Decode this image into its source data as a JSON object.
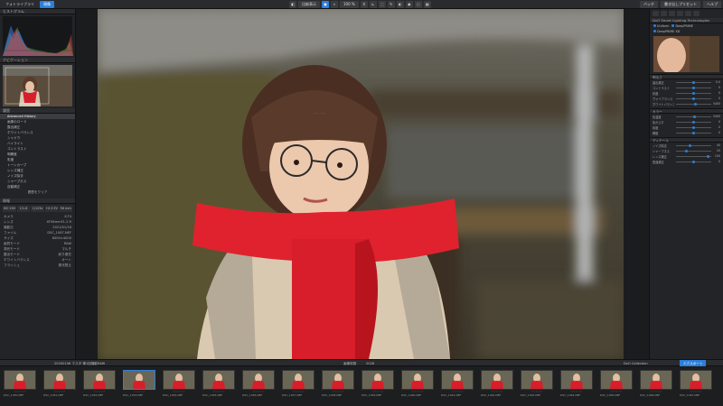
{
  "topbar": {
    "tab_library": "フォトライブラリ",
    "tab_develop": "現像",
    "zoom_label": "100 %",
    "mode_label": "比較表示",
    "button_batch": "バッチ",
    "button_export": "書き出しプリセット",
    "button_help": "ヘルプ"
  },
  "left": {
    "panel_title": "ヒストグラム",
    "histogram_title": "ヒストグラム",
    "navigator_title": "ナビゲーション",
    "history_title": "履歴",
    "history_head": "Advanced History",
    "history_items": [
      "画像のロード",
      "露出補正",
      "ホワイトバランス",
      "シャドウ",
      "ハイライト",
      "コントラスト",
      "明瞭度",
      "彩度",
      "トーンカーブ",
      "レンズ補正",
      "ノイズ除去",
      "シャープネス",
      "自動補正"
    ],
    "history_action": "履歴をクリア",
    "section_info": "情報",
    "camera_buttons": [
      "ISO 200",
      "1/1.8",
      "1/125s",
      "+0.3 EV",
      "56 mm"
    ],
    "info_rows": [
      {
        "k": "カメラ",
        "v": "X-T4"
      },
      {
        "k": "レンズ",
        "v": "XF56mmF1.2 R"
      },
      {
        "k": "撮影日",
        "v": "2021/01/16"
      },
      {
        "k": "ファイル",
        "v": "DSC_1087.NEF"
      },
      {
        "k": "サイズ",
        "v": "6000×4000"
      },
      {
        "k": "画質モード",
        "v": "RAW"
      },
      {
        "k": "測光モード",
        "v": "マルチ"
      },
      {
        "k": "露出モード",
        "v": "絞り優先"
      },
      {
        "k": "ホワイトバランス",
        "v": "オート"
      },
      {
        "k": "フラッシュ",
        "v": "発光禁止"
      }
    ]
  },
  "right": {
    "panel_title": "DxO Smart Lighting Technologies",
    "toggles": [
      "Uniform",
      "DeepPRIME",
      "DeepPRIME XD"
    ],
    "section_light": "明るさ",
    "sliders_light": [
      {
        "label": "露出補正",
        "value": "0.0",
        "pos": 0.5
      },
      {
        "label": "コントラスト",
        "value": "0",
        "pos": 0.5
      },
      {
        "label": "彩度",
        "value": "0",
        "pos": 0.5
      },
      {
        "label": "ヴァイブランス",
        "value": "0",
        "pos": 0.5
      },
      {
        "label": "ホワイトバランス",
        "value": "5400",
        "pos": 0.55
      }
    ],
    "section_color": "カラー",
    "sliders_color": [
      {
        "label": "色温度",
        "value": "5400",
        "pos": 0.52
      },
      {
        "label": "色かぶり",
        "value": "0",
        "pos": 0.5
      },
      {
        "label": "彩度",
        "value": "0",
        "pos": 0.5
      },
      {
        "label": "輝度",
        "value": "0",
        "pos": 0.5
      }
    ],
    "section_detail": "ディテール",
    "sliders_detail": [
      {
        "label": "ノイズ除去",
        "value": "40",
        "pos": 0.4
      },
      {
        "label": "シャープネス",
        "value": "20",
        "pos": 0.3
      },
      {
        "label": "レンズ補正",
        "value": "100",
        "pos": 0.9
      },
      {
        "label": "歪曲補正",
        "value": "0",
        "pos": 0.5
      }
    ]
  },
  "strip": {
    "folder": "20200106 マスタ 第1回撮影RAW",
    "count": "2028",
    "count_label": "画像枚数",
    "collection": "DxO Collection",
    "export_btn": "エクスポート",
    "thumbs": [
      "DSC_1050.NEF",
      "DSC_1051.NEF",
      "DSC_1052.NEF",
      "DSC_1053.NEF",
      "DSC_1054.NEF",
      "DSC_1055.NEF",
      "DSC_1056.NEF",
      "DSC_1057.NEF",
      "DSC_1058.NEF",
      "DSC_1059.NEF",
      "DSC_1060.NEF",
      "DSC_1061.NEF",
      "DSC_1062.NEF",
      "DSC_1063.NEF",
      "DSC_1064.NEF",
      "DSC_1065.NEF",
      "DSC_1066.NEF",
      "DSC_1067.NEF"
    ],
    "selected_index": 3
  }
}
